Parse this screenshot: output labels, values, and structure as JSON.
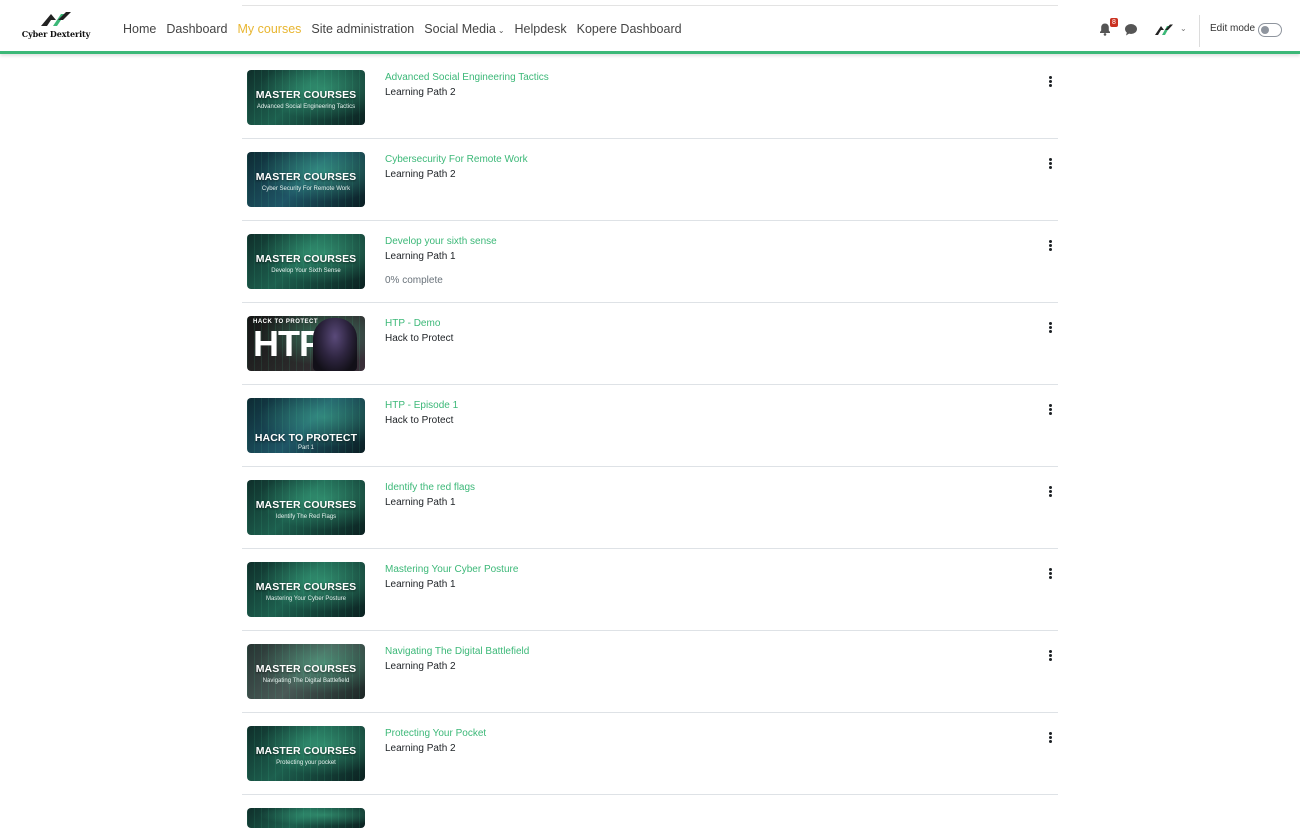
{
  "brand": {
    "name": "Cyber Dexterity"
  },
  "nav": {
    "links": [
      {
        "label": "Home"
      },
      {
        "label": "Dashboard"
      },
      {
        "label": "My courses",
        "active": true
      },
      {
        "label": "Site administration"
      },
      {
        "label": "Social Media",
        "dropdown": true
      },
      {
        "label": "Helpdesk"
      },
      {
        "label": "Kopere Dashboard"
      }
    ],
    "notification_count": "8",
    "edit_mode_label": "Edit mode",
    "edit_mode_on": false
  },
  "colors": {
    "accent": "#3cb878",
    "active_link": "#e8b631",
    "badge": "#ca3120"
  },
  "courses": [
    {
      "title": "Advanced Social Engineering Tactics",
      "category": "Learning Path 2",
      "thumb_title": "MASTER COURSES",
      "thumb_sub": "Advanced Social Engineering Tactics",
      "progress": ""
    },
    {
      "title": "Cybersecurity For Remote Work",
      "category": "Learning Path 2",
      "thumb_title": "MASTER COURSES",
      "thumb_sub": "Cyber Security For Remote Work",
      "progress": ""
    },
    {
      "title": "Develop your sixth sense",
      "category": "Learning Path 1",
      "thumb_title": "MASTER COURSES",
      "thumb_sub": "Develop Your Sixth Sense",
      "progress": "0% complete"
    },
    {
      "title": "HTP - Demo",
      "category": "Hack to Protect",
      "thumb_title": "HTP",
      "thumb_sub": "HACK TO PROTECT",
      "progress": ""
    },
    {
      "title": "HTP - Episode 1",
      "category": "Hack to Protect",
      "thumb_title": "HACK TO PROTECT",
      "thumb_sub": "Part 1",
      "progress": ""
    },
    {
      "title": "Identify the red flags",
      "category": "Learning Path 1",
      "thumb_title": "MASTER COURSES",
      "thumb_sub": "Identify The Red Flags",
      "progress": ""
    },
    {
      "title": "Mastering Your Cyber Posture",
      "category": "Learning Path 1",
      "thumb_title": "MASTER COURSES",
      "thumb_sub": "Mastering Your Cyber Posture",
      "progress": ""
    },
    {
      "title": "Navigating The Digital Battlefield",
      "category": "Learning Path 2",
      "thumb_title": "MASTER COURSES",
      "thumb_sub": "Navigating The Digital Battlefield",
      "progress": ""
    },
    {
      "title": "Protecting Your Pocket",
      "category": "Learning Path 2",
      "thumb_title": "MASTER COURSES",
      "thumb_sub": "Protecting your pocket",
      "progress": ""
    }
  ]
}
